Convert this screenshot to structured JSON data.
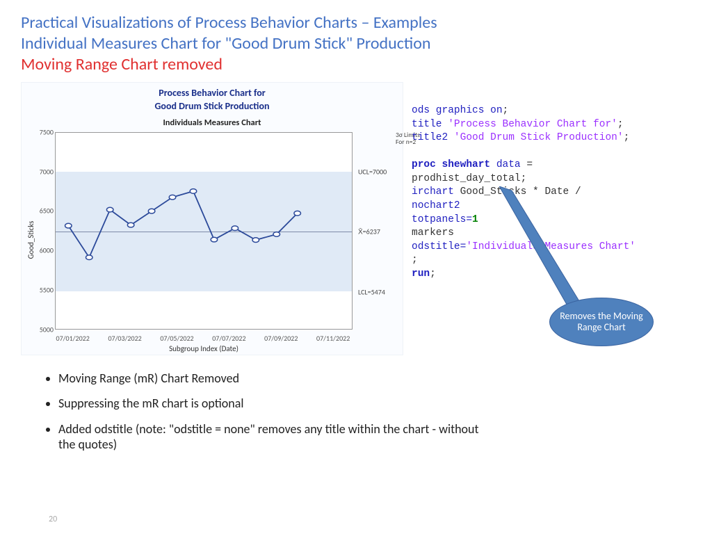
{
  "heading": {
    "line1": "Practical Visualizations of Process Behavior Charts – Examples",
    "line2": "Individual Measures Chart for \"Good Drum Stick\" Production",
    "line3": "Moving Range Chart removed"
  },
  "chart_data": {
    "type": "line",
    "title_line1": "Process Behavior Chart for",
    "title_line2": "Good Drum Stick Production",
    "subtitle": "Individuals Measures Chart",
    "xlabel": "Subgroup Index (Date)",
    "ylabel": "Good_Sticks",
    "ylim": [
      5000,
      7500
    ],
    "y_ticks": [
      5000,
      5500,
      6000,
      6500,
      7000,
      7500
    ],
    "x_tick_labels": [
      "07/01/2022",
      "07/03/2022",
      "07/05/2022",
      "07/07/2022",
      "07/09/2022",
      "07/11/2022"
    ],
    "x_tick_positions_pct": [
      6,
      23.5,
      41,
      58.5,
      76,
      93.5
    ],
    "series": [
      {
        "name": "Good_Sticks",
        "x": [
          1,
          2,
          3,
          4,
          5,
          6,
          7,
          8,
          9,
          10,
          11,
          12
        ],
        "values": [
          6195,
          5750,
          6420,
          6205,
          6400,
          6595,
          6680,
          6000,
          6160,
          5995,
          6075,
          6370
        ]
      }
    ],
    "ucl": 7000,
    "mean": 6237,
    "lcl": 5474,
    "ucl_label": "UCL=7000",
    "mean_label": "X̄=6237",
    "lcl_label": "LCL=5474",
    "sigma_note_l1": "3σ Limits",
    "sigma_note_l2": "For n=2"
  },
  "code": {
    "l1_a": "ods graphics on",
    "l1_b": ";",
    "l2_a": "title ",
    "l2_s": "'Process Behavior Chart for'",
    "l2_b": ";",
    "l3_a": "title2 ",
    "l3_s": "'Good Drum Stick Production'",
    "l3_b": ";",
    "l5_a": "proc shewhart ",
    "l5_b": "data ",
    "l5_c": "=",
    "l6": "prodhist_day_total;",
    "l7_a": "irchart ",
    "l7_b": "Good_Sticks * Date /",
    "l8": "nochart2",
    "l9_a": "totpanels=",
    "l9_b": "1",
    "l10": "markers",
    "l11_a": "odstitle=",
    "l11_s": "'Individuals Measures Chart'",
    "l12": ";",
    "l13_a": "run",
    "l13_b": ";"
  },
  "callout": "Removes the Moving Range Chart",
  "bullets": [
    "Moving Range (mR) Chart Removed",
    "Suppressing the mR chart is optional",
    "Added odstitle (note: \"odstitle = none\" removes any title within the chart - without the quotes)"
  ],
  "page_number": "20"
}
